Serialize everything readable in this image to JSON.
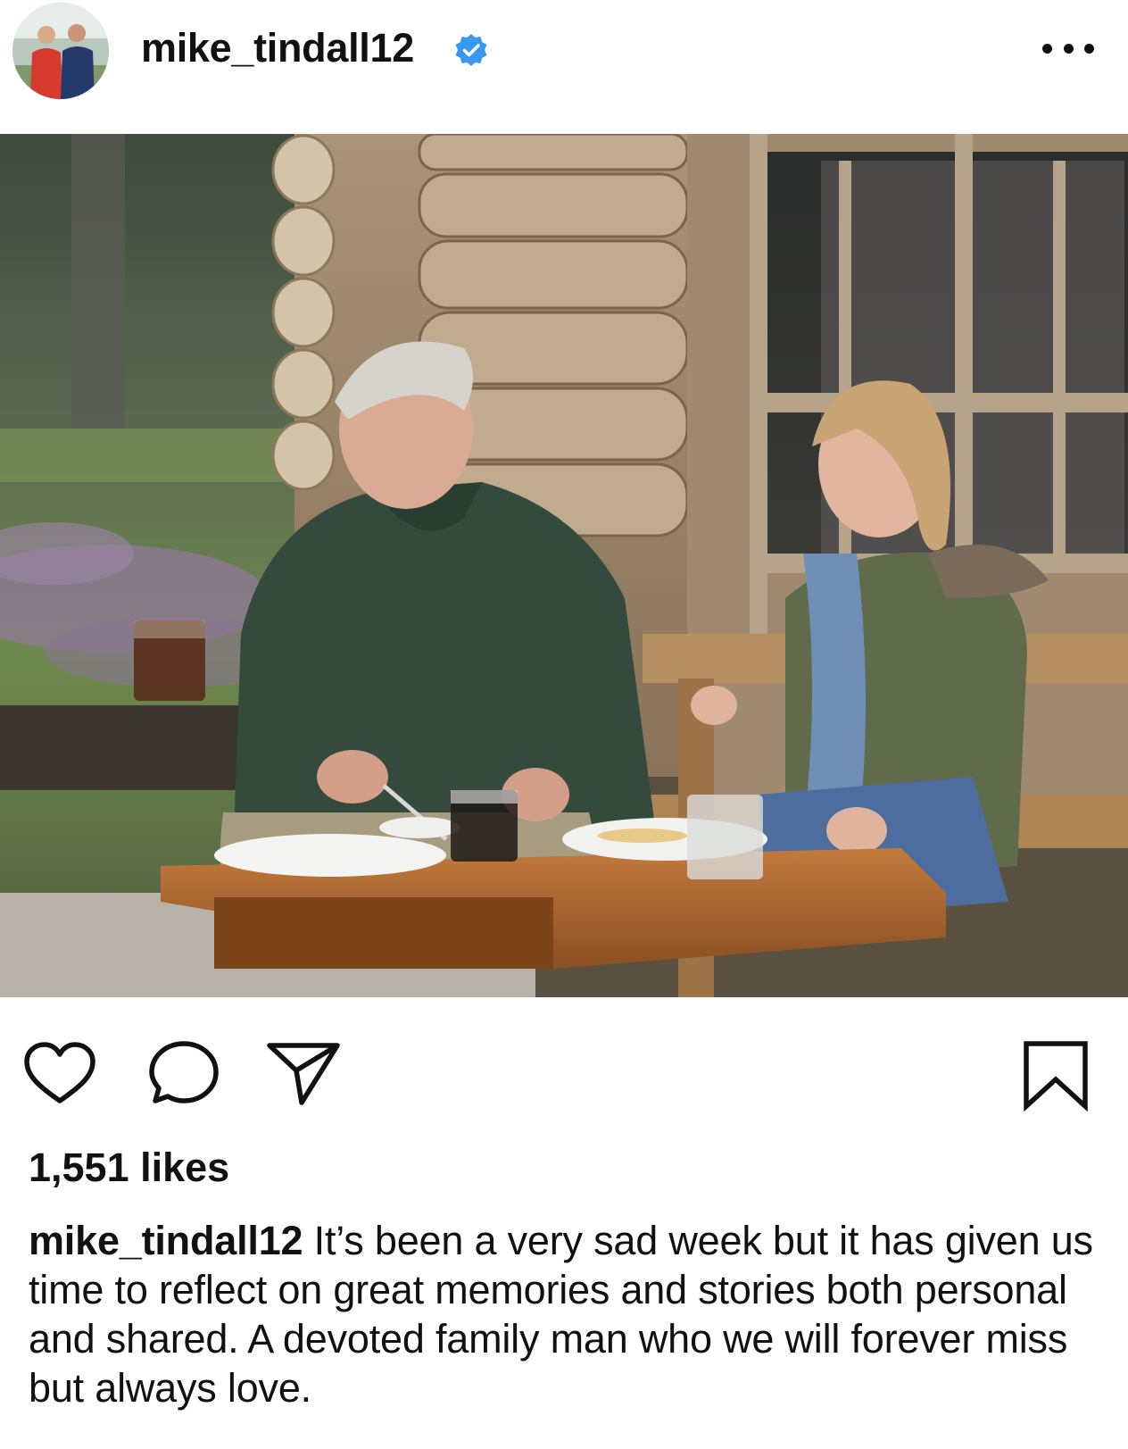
{
  "header": {
    "username": "mike_tindall12",
    "verified_icon": "verified-badge-icon",
    "verified_color": "#3897f0",
    "more_icon": "more-options-icon"
  },
  "photo": {
    "icon": "post-photo"
  },
  "actions": {
    "like_icon": "heart-icon",
    "comment_icon": "comment-icon",
    "share_icon": "paper-plane-icon",
    "save_icon": "bookmark-icon"
  },
  "likes": {
    "text": "1,551 likes"
  },
  "caption": {
    "username": "mike_tindall12",
    "text": "It’s been a very sad week but it has given us time to reflect on great memories and stories both personal and shared. A devoted family man who we will forever miss but always love."
  }
}
